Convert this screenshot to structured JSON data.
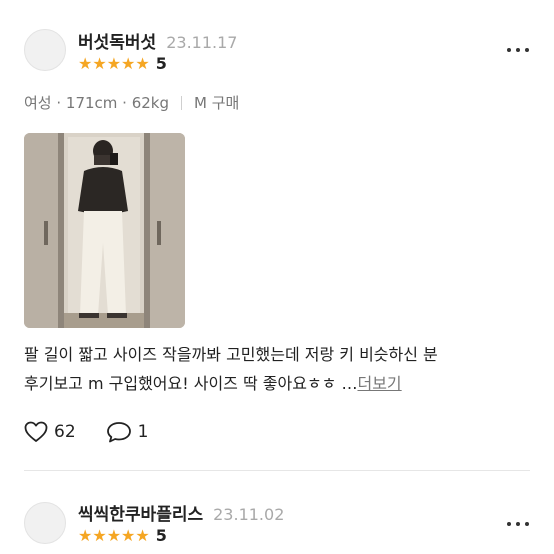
{
  "reviews": [
    {
      "username": "버섯독버섯",
      "date": "23.11.17",
      "rating": 5,
      "rating_label": "5",
      "meta": {
        "profile": "여성 · 171cm · 62kg",
        "purchase": "M 구매"
      },
      "text_line1": "팔 길이 짧고 사이즈 작을까봐 고민했는데 저랑 키 비슷하신 분",
      "text_line2": "후기보고 m 구입했어요! 사이즈 딱 좋아요ㅎㅎ …",
      "more_label": "더보기",
      "likes": "62",
      "comments": "1"
    },
    {
      "username": "씩씩한쿠바플리스",
      "date": "23.11.02",
      "rating": 5,
      "rating_label": "5"
    }
  ],
  "colors": {
    "star": "#f5a623",
    "muted_text": "#a9a9a9",
    "divider": "#e6e6e6"
  },
  "icons": {
    "like": "heart-outline-icon",
    "comment": "speech-bubble-icon",
    "more": "more-horizontal-icon",
    "rating": "star-icon"
  }
}
